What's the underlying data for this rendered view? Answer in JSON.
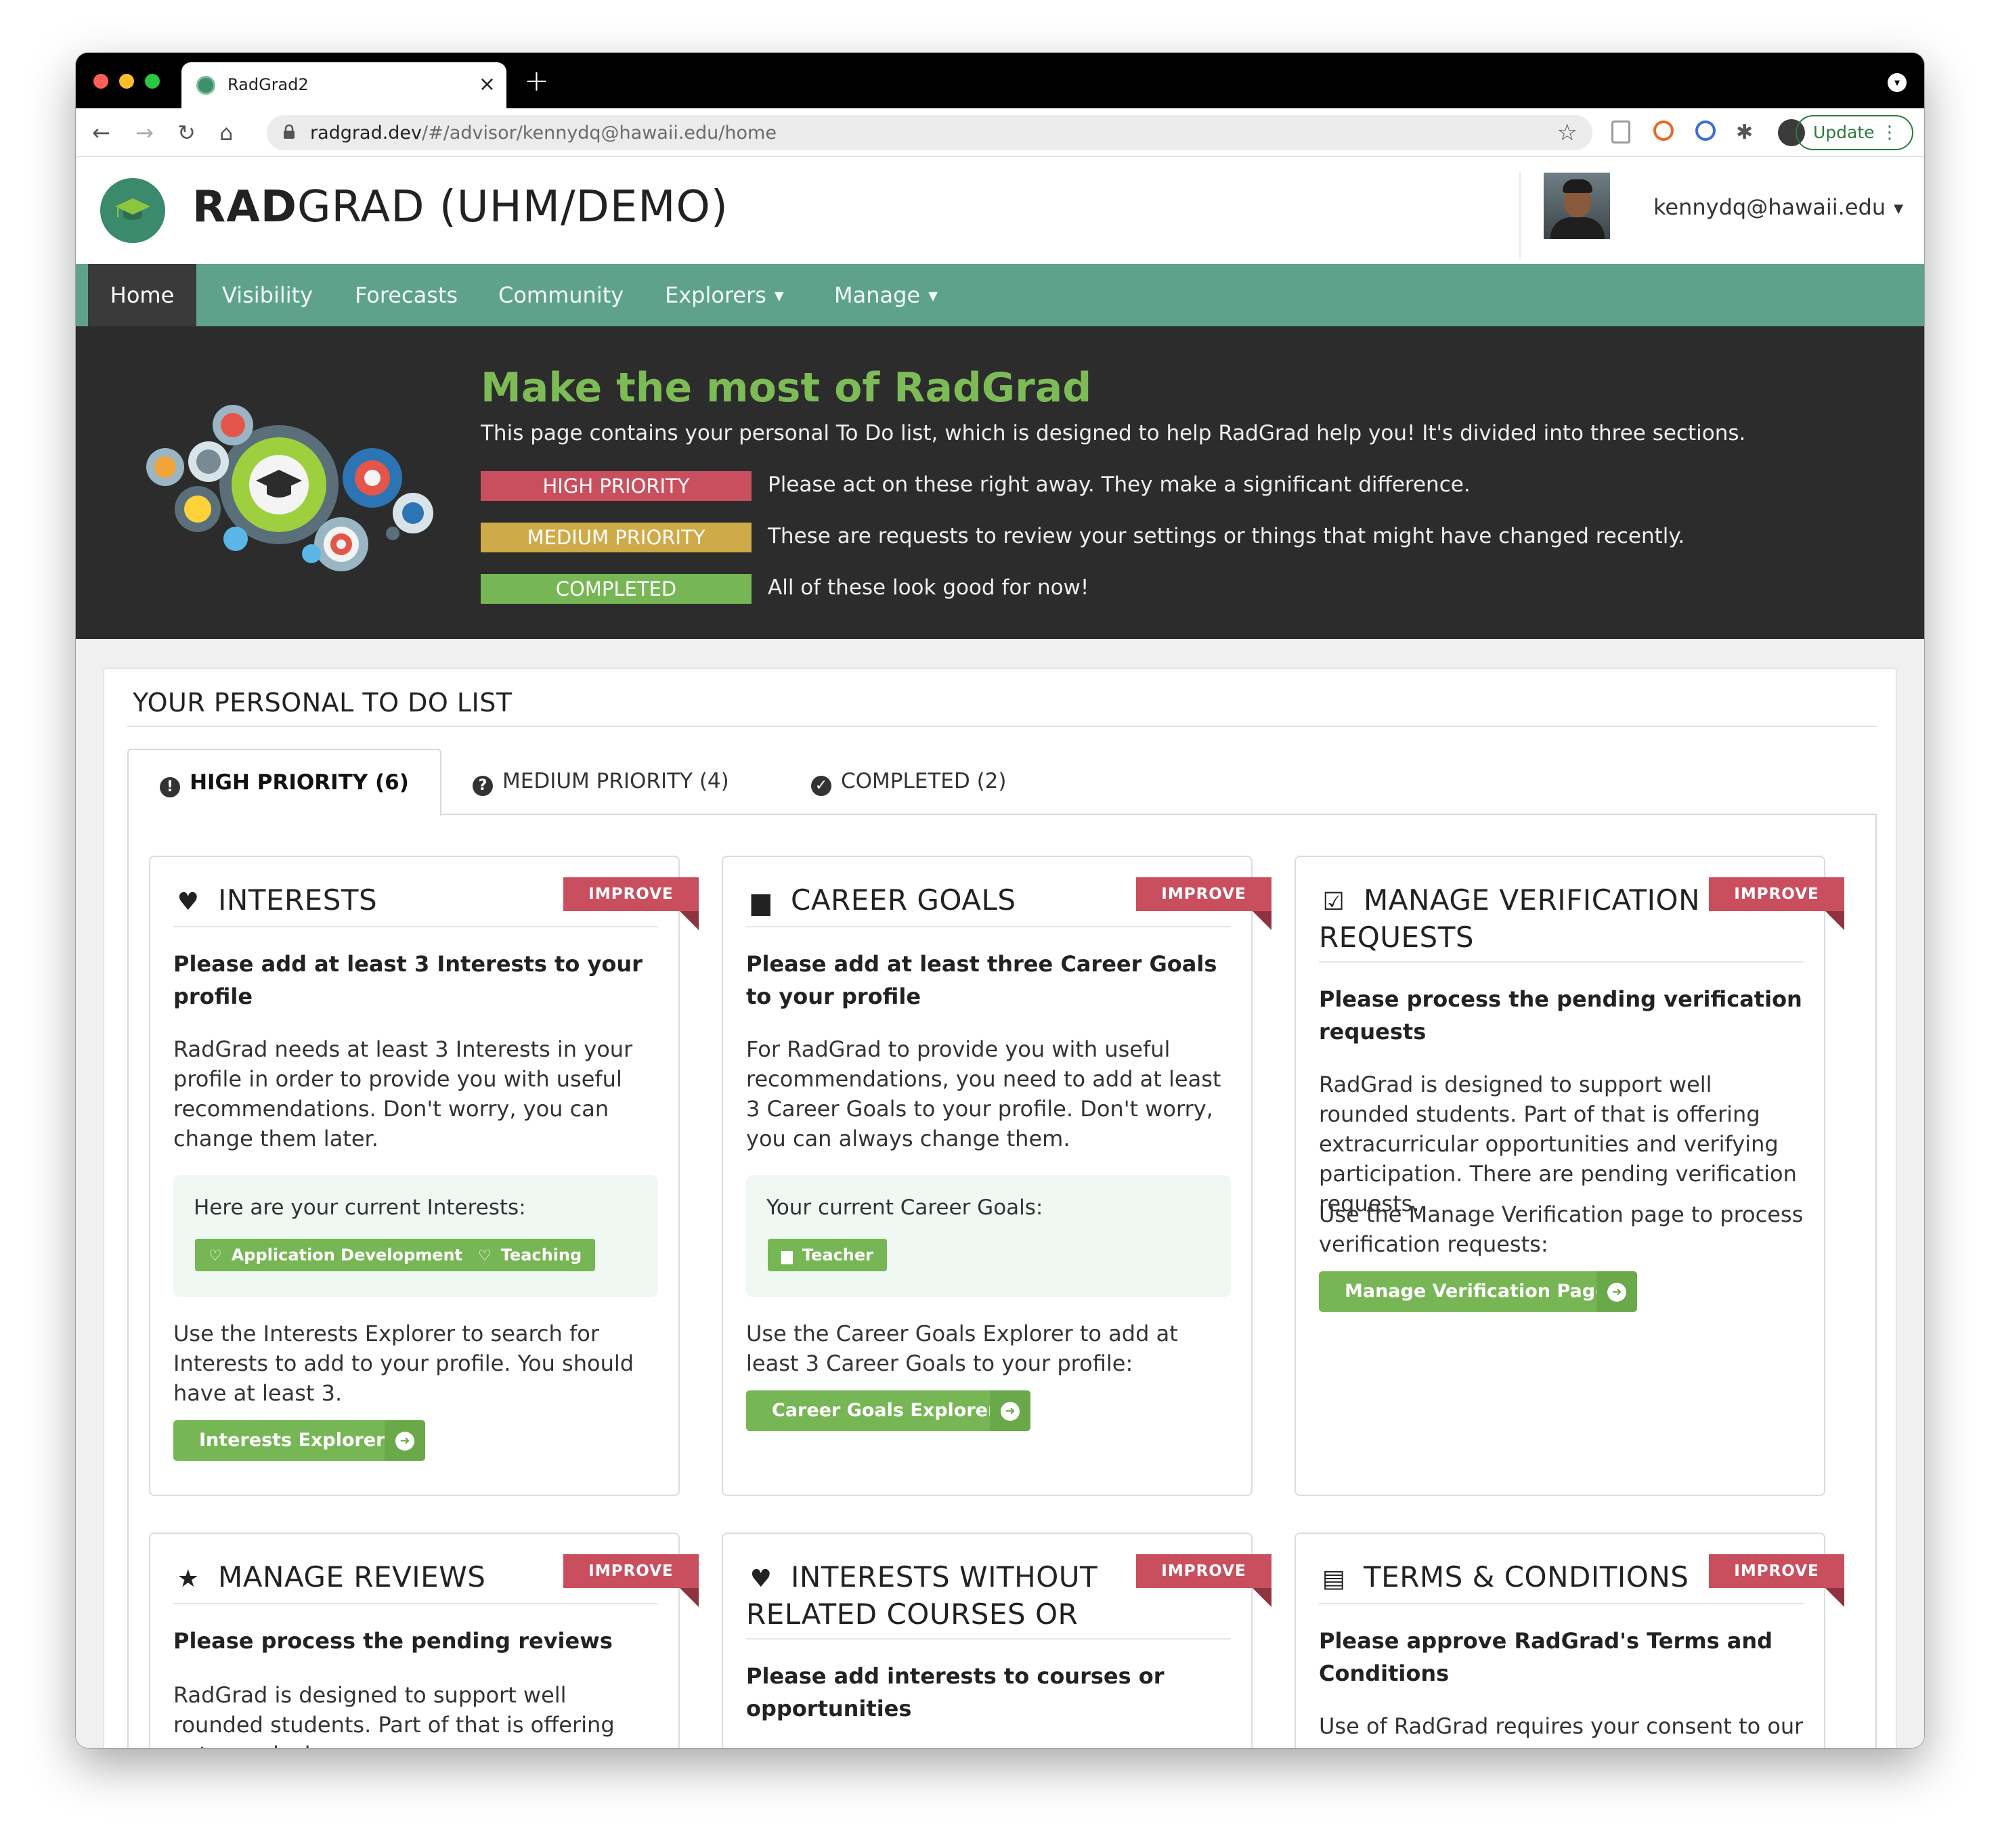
{
  "browser": {
    "tab_title": "RadGrad2",
    "url_domain": "radgrad.dev",
    "url_path": "/#/advisor/kennydq@hawaii.edu/home",
    "update_label": "Update"
  },
  "header": {
    "brand_bold": "RAD",
    "brand_rest": "GRAD (UHM/DEMO)",
    "user_email": "kennydq@hawaii.edu"
  },
  "nav": {
    "items": [
      {
        "label": "Home",
        "active": true
      },
      {
        "label": "Visibility"
      },
      {
        "label": "Forecasts"
      },
      {
        "label": "Community"
      },
      {
        "label": "Explorers",
        "dropdown": true
      },
      {
        "label": "Manage",
        "dropdown": true
      }
    ]
  },
  "banner": {
    "title": "Make the most of RadGrad",
    "subtitle": "This page contains your personal To Do list, which is designed to help RadGrad help you! It's divided into three sections.",
    "legend": [
      {
        "chip": "HIGH PRIORITY",
        "text": "Please act on these right away. They make a significant difference.",
        "color": "#c94f5f"
      },
      {
        "chip": "MEDIUM PRIORITY",
        "text": "These are requests to review your settings or things that might have changed recently.",
        "color": "#cfaa48"
      },
      {
        "chip": "COMPLETED",
        "text": "All of these look good for now!",
        "color": "#77b654"
      }
    ]
  },
  "todo": {
    "title": "YOUR PERSONAL TO DO LIST",
    "tabs": [
      {
        "label": "HIGH PRIORITY (6)",
        "icon": "exclamation-circle-icon",
        "active": true
      },
      {
        "label": "MEDIUM PRIORITY (4)",
        "icon": "question-circle-icon"
      },
      {
        "label": "COMPLETED (2)",
        "icon": "check-circle-icon"
      }
    ],
    "cards": [
      {
        "icon": "heart-icon",
        "title": "INTERESTS",
        "ribbon": "IMPROVE",
        "subtitle": "Please add at least 3 Interests to your profile",
        "body": "RadGrad needs at least 3 Interests in your profile in order to provide you with useful recommendations. Don't worry, you can change them later.",
        "current_label": "Here are your current Interests:",
        "chips": [
          "Application Development",
          "Teaching"
        ],
        "footer": "Use the Interests Explorer to search for Interests to add to your profile. You should have at least 3.",
        "button": "Interests Explorer"
      },
      {
        "icon": "briefcase-icon",
        "title": "CAREER GOALS",
        "ribbon": "IMPROVE",
        "subtitle": "Please add at least three Career Goals to your profile",
        "body": "For RadGrad to provide you with useful recommendations, you need to add at least 3 Career Goals to your profile. Don't worry, you can always change them.",
        "current_label": "Your current Career Goals:",
        "chips": [
          "Teacher"
        ],
        "footer": "Use the Career Goals Explorer to add at least 3 Career Goals to your profile:",
        "button": "Career Goals Explorer"
      },
      {
        "icon": "check-square-icon",
        "title": "MANAGE VERIFICATION REQUESTS",
        "ribbon": "IMPROVE",
        "subtitle": "Please process the pending verification requests",
        "body": "RadGrad is designed to support well rounded students. Part of that is offering extracurricular opportunities and verifying participation. There are pending verification requests.",
        "footer": "Use the Manage Verification page to process verification requests:",
        "button": "Manage Verification Page"
      },
      {
        "icon": "star-half-icon",
        "title": "MANAGE REVIEWS",
        "ribbon": "IMPROVE",
        "subtitle": "Please process the pending reviews",
        "body": "RadGrad is designed to support well rounded students. Part of that is offering extracurricular"
      },
      {
        "icon": "heart-icon",
        "title": "INTERESTS WITHOUT RELATED COURSES OR OPPORTUNITIES",
        "ribbon": "IMPROVE",
        "subtitle": "Please add interests to courses or opportunities"
      },
      {
        "icon": "file-icon",
        "title": "TERMS & CONDITIONS",
        "ribbon": "IMPROVE",
        "subtitle": "Please approve RadGrad's Terms and Conditions",
        "body": "Use of RadGrad requires your consent to our"
      }
    ]
  },
  "colors": {
    "nav_green": "#5fa28c",
    "banner_dark": "#2c2c2c",
    "title_green": "#7dbb56",
    "high": "#c94f5f",
    "medium": "#cfaa48",
    "completed": "#77b654"
  }
}
